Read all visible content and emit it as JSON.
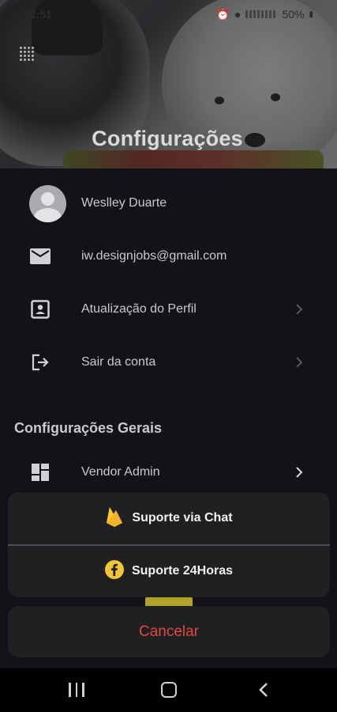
{
  "status_bar": {
    "time": "12:51",
    "battery": "50%"
  },
  "header": {
    "title": "Configurações"
  },
  "account_rows": [
    {
      "label": "Weslley Duarte",
      "icon": "avatar"
    },
    {
      "label": "iw.designjobs@gmail.com",
      "icon": "mail-icon"
    },
    {
      "label": "Atualização do Perfil",
      "icon": "profile-card-icon"
    },
    {
      "label": "Sair da conta",
      "icon": "logout-icon"
    }
  ],
  "general_section": {
    "title": "Configurações Gerais",
    "items": [
      {
        "label": "Vendor Admin",
        "icon": "dashboard-icon"
      }
    ]
  },
  "action_sheet": {
    "options": [
      {
        "label": "Suporte via Chat",
        "icon": "firebase-icon"
      },
      {
        "label": "Suporte 24Horas",
        "icon": "facebook-icon"
      }
    ],
    "cancel_label": "Cancelar"
  },
  "colors": {
    "background": "#121316",
    "sheet": "#1f2022",
    "cancel_text": "#e0483f",
    "firebase": "#f5a623",
    "facebook_badge": "#f2c43a"
  },
  "nav_bar": {
    "buttons": [
      "recent-apps",
      "home",
      "back"
    ]
  }
}
